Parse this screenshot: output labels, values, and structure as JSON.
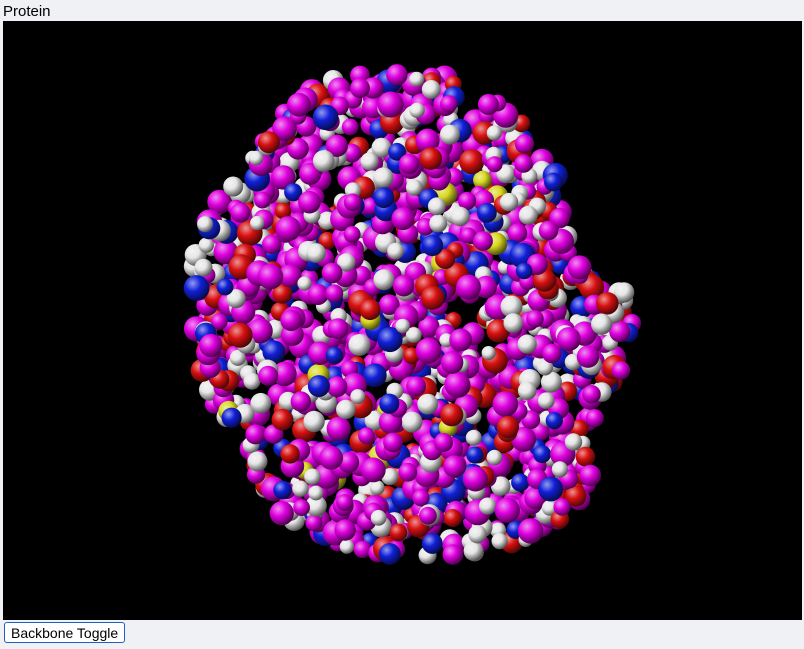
{
  "page": {
    "title": "Protein"
  },
  "viewer": {
    "background_color": "#000000",
    "representation": "space-filling",
    "atom_colors": {
      "carbon": "#e000e0",
      "hydrogen": "#e6e6e6",
      "oxygen": "#d81010",
      "nitrogen": "#1020d8",
      "sulfur": "#d8d820"
    }
  },
  "controls": {
    "backbone_toggle_label": "Backbone Toggle"
  }
}
